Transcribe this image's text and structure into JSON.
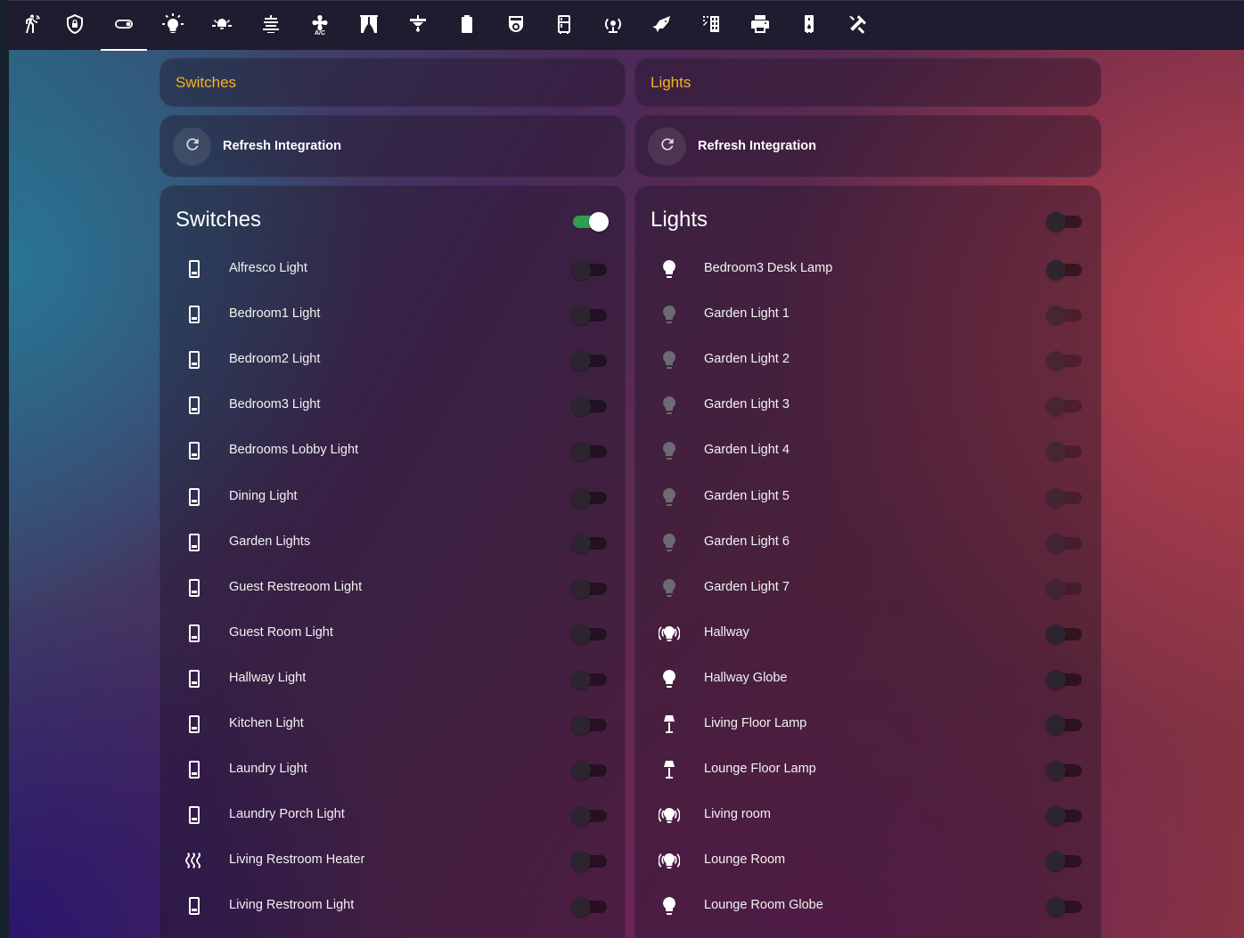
{
  "topbar": {
    "tabs": [
      {
        "icon": "motion-sensor-icon"
      },
      {
        "icon": "shield-lock-icon"
      },
      {
        "icon": "toggle-switch-icon",
        "active": true
      },
      {
        "icon": "lightbulb-on-icon"
      },
      {
        "icon": "ceiling-light-multiple-icon"
      },
      {
        "icon": "string-lights-icon"
      },
      {
        "icon": "air-conditioner-icon"
      },
      {
        "icon": "curtains-icon"
      },
      {
        "icon": "ceiling-fan-icon"
      },
      {
        "icon": "battery-icon"
      },
      {
        "icon": "robot-vacuum-icon"
      },
      {
        "icon": "fridge-icon"
      },
      {
        "icon": "access-point-icon"
      },
      {
        "icon": "bird-icon"
      },
      {
        "icon": "solar-power-icon"
      },
      {
        "icon": "printer-icon"
      },
      {
        "icon": "water-heater-icon"
      },
      {
        "icon": "hammer-wrench-icon"
      }
    ]
  },
  "switches": {
    "heading": "Switches",
    "refresh_label": "Refresh Integration",
    "card_title": "Switches",
    "master_on": true,
    "items": [
      {
        "name": "Alfresco Light",
        "icon": "light-switch-icon",
        "on": false
      },
      {
        "name": "Bedroom1 Light",
        "icon": "light-switch-icon",
        "on": false
      },
      {
        "name": "Bedroom2 Light",
        "icon": "light-switch-icon",
        "on": false
      },
      {
        "name": "Bedroom3 Light",
        "icon": "light-switch-icon",
        "on": false
      },
      {
        "name": "Bedrooms Lobby Light",
        "icon": "light-switch-icon",
        "on": false
      },
      {
        "name": "Dining Light",
        "icon": "light-switch-icon",
        "on": false
      },
      {
        "name": "Garden Lights",
        "icon": "light-switch-icon",
        "on": false
      },
      {
        "name": "Guest Restreoom Light",
        "icon": "light-switch-icon",
        "on": false
      },
      {
        "name": "Guest Room Light",
        "icon": "light-switch-icon",
        "on": false
      },
      {
        "name": "Hallway Light",
        "icon": "light-switch-icon",
        "on": false
      },
      {
        "name": "Kitchen Light",
        "icon": "light-switch-icon",
        "on": false
      },
      {
        "name": "Laundry Light",
        "icon": "light-switch-icon",
        "on": false
      },
      {
        "name": "Laundry Porch Light",
        "icon": "light-switch-icon",
        "on": false
      },
      {
        "name": "Living Restroom Heater",
        "icon": "heat-wave-icon",
        "on": false
      },
      {
        "name": "Living Restroom Light",
        "icon": "light-switch-icon",
        "on": false
      }
    ]
  },
  "lights": {
    "heading": "Lights",
    "refresh_label": "Refresh Integration",
    "card_title": "Lights",
    "master_on": false,
    "items": [
      {
        "name": "Bedroom3 Desk Lamp",
        "icon": "lightbulb-icon",
        "available": true
      },
      {
        "name": "Garden Light 1",
        "icon": "lightbulb-icon",
        "available": false
      },
      {
        "name": "Garden Light 2",
        "icon": "lightbulb-icon",
        "available": false
      },
      {
        "name": "Garden Light 3",
        "icon": "lightbulb-icon",
        "available": false
      },
      {
        "name": "Garden Light 4",
        "icon": "lightbulb-icon",
        "available": false
      },
      {
        "name": "Garden Light 5",
        "icon": "lightbulb-icon",
        "available": false
      },
      {
        "name": "Garden Light 6",
        "icon": "lightbulb-icon",
        "available": false
      },
      {
        "name": "Garden Light 7",
        "icon": "lightbulb-icon",
        "available": false
      },
      {
        "name": "Hallway",
        "icon": "lightbulb-group-icon",
        "available": true
      },
      {
        "name": "Hallway Globe",
        "icon": "lightbulb-icon",
        "available": true
      },
      {
        "name": "Living Floor Lamp",
        "icon": "floor-lamp-icon",
        "available": true
      },
      {
        "name": "Lounge Floor Lamp",
        "icon": "floor-lamp-icon",
        "available": true
      },
      {
        "name": "Living room",
        "icon": "lightbulb-group-icon",
        "available": true
      },
      {
        "name": "Lounge Room",
        "icon": "lightbulb-group-icon",
        "available": true
      },
      {
        "name": "Lounge Room Globe",
        "icon": "lightbulb-icon",
        "available": true
      }
    ]
  },
  "colors": {
    "heading": "#f5b321",
    "toggle_on": "#2e9f4f",
    "topbar": "#201b2e"
  }
}
